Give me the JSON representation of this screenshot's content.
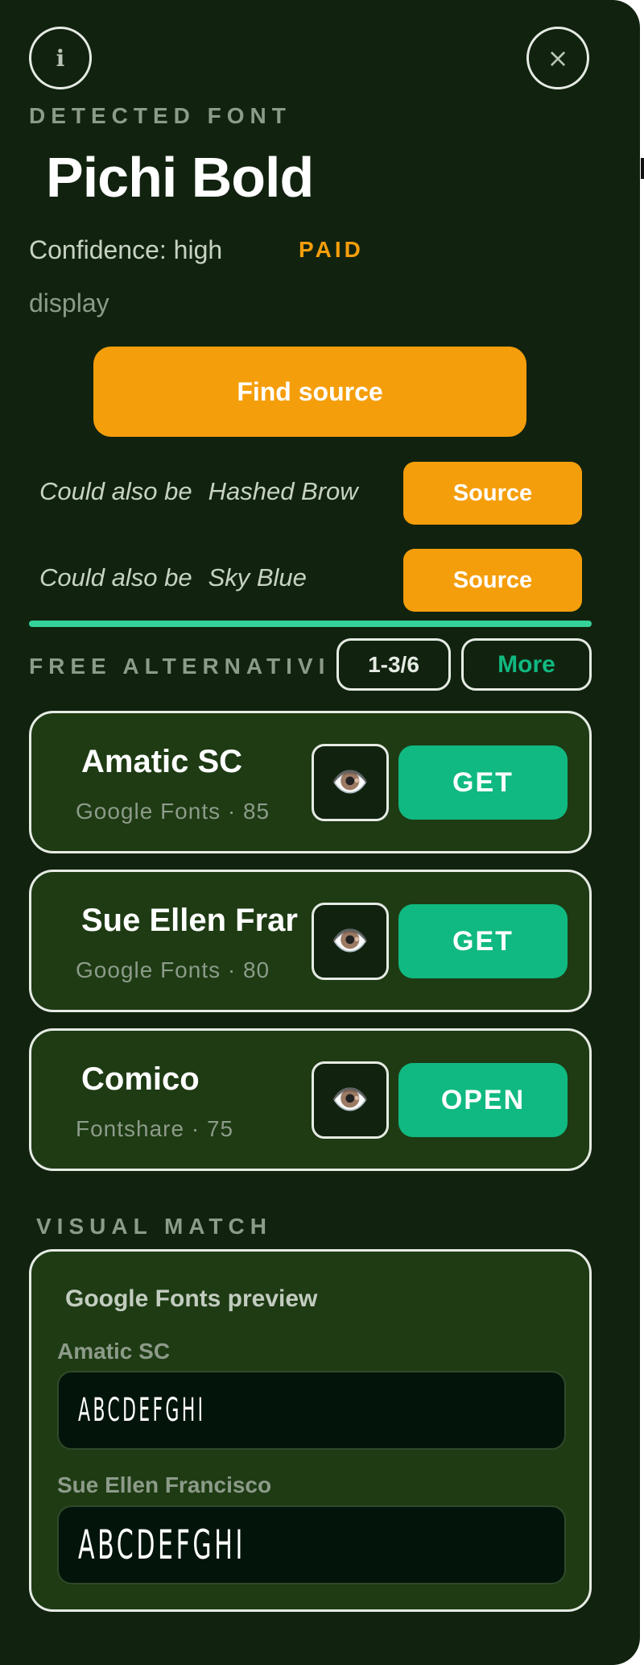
{
  "header": {
    "info_glyph": "i",
    "close_glyph": "×",
    "section_label": "DETECTED FONT",
    "font_name": "Pichi Bold",
    "confidence": "Confidence: high",
    "license": "PAID",
    "category": "display"
  },
  "find_source_label": "Find source",
  "alternatives": [
    {
      "prefix": "Could also be",
      "name": "Hashed Brow",
      "button": "Source"
    },
    {
      "prefix": "Could also be",
      "name": "Sky Blue",
      "button": "Source"
    }
  ],
  "free": {
    "label": "FREE ALTERNATIVI",
    "pager": "1-3/6",
    "more_label": "More"
  },
  "cards": [
    {
      "title": "Amatic SC",
      "subtitle": "Google Fonts · 85",
      "eye": "👁️",
      "action": "GET"
    },
    {
      "title": "Sue Ellen Frar",
      "subtitle": "Google Fonts · 80",
      "eye": "👁️",
      "action": "GET"
    },
    {
      "title": "Comico",
      "subtitle": "Fontshare · 75",
      "eye": "👁️",
      "action": "OPEN"
    }
  ],
  "visual": {
    "label": "VISUAL MATCH",
    "preview_title": "Google Fonts preview",
    "items": [
      {
        "font": "Amatic SC",
        "sample": "ABCDEFGHI"
      },
      {
        "font": "Sue Ellen Francisco",
        "sample": "ABCDEFGHI"
      }
    ]
  },
  "colors": {
    "panel_bg": "#11230f",
    "card_bg": "#1e3b14",
    "accent_orange": "#f59e0b",
    "accent_green": "#10b981",
    "divider_green": "#34d399"
  }
}
